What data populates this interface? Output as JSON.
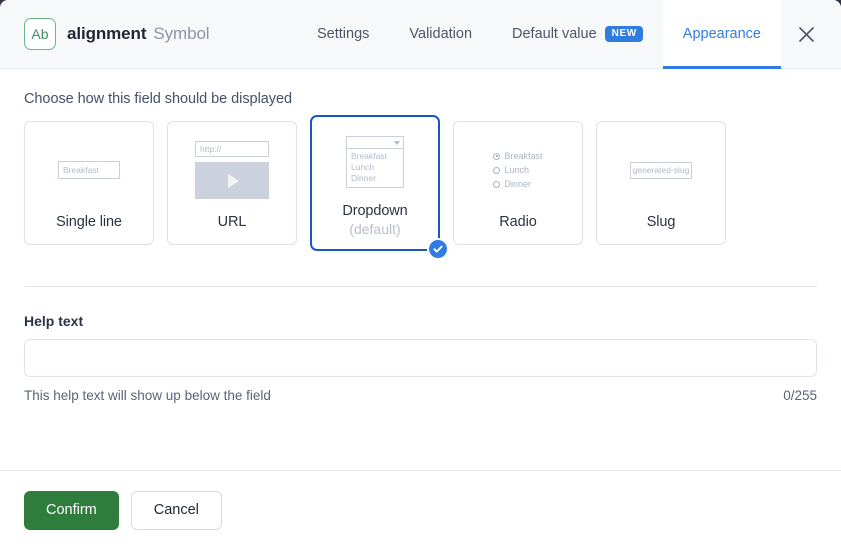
{
  "header": {
    "type_badge": "Ab",
    "field_name": "alignment",
    "field_type": "Symbol",
    "close_icon": "close-icon",
    "tabs": [
      {
        "label": "Settings",
        "active": false,
        "badge": null
      },
      {
        "label": "Validation",
        "active": false,
        "badge": null
      },
      {
        "label": "Default value",
        "active": false,
        "badge": "NEW"
      },
      {
        "label": "Appearance",
        "active": true,
        "badge": null
      }
    ]
  },
  "main": {
    "section_title": "Choose how this field should be displayed",
    "options": [
      {
        "label": "Single line",
        "sublabel": "",
        "selected": false,
        "preview": "single-line",
        "placeholder": "Breakfast"
      },
      {
        "label": "URL",
        "sublabel": "",
        "selected": false,
        "preview": "url",
        "placeholder": "http://"
      },
      {
        "label": "Dropdown",
        "sublabel": "(default)",
        "selected": true,
        "preview": "dropdown",
        "options": [
          "Breakfast",
          "Lunch",
          "Dinner"
        ]
      },
      {
        "label": "Radio",
        "sublabel": "",
        "selected": false,
        "preview": "radio",
        "options": [
          "Breakfast",
          "Lunch",
          "Dinner"
        ],
        "checked_index": 0
      },
      {
        "label": "Slug",
        "sublabel": "",
        "selected": false,
        "preview": "slug",
        "placeholder": "generated-slug"
      }
    ]
  },
  "help": {
    "label": "Help text",
    "value": "",
    "placeholder": "",
    "hint": "This help text will show up below the field",
    "counter": "0/255"
  },
  "footer": {
    "confirm_label": "Confirm",
    "cancel_label": "Cancel"
  },
  "colors": {
    "accent_blue": "#2f7de1",
    "selected_border": "#1a56c4",
    "confirm_green": "#2f7d3c",
    "badge_green": "#68b588",
    "header_bg": "#f7f8fa"
  }
}
